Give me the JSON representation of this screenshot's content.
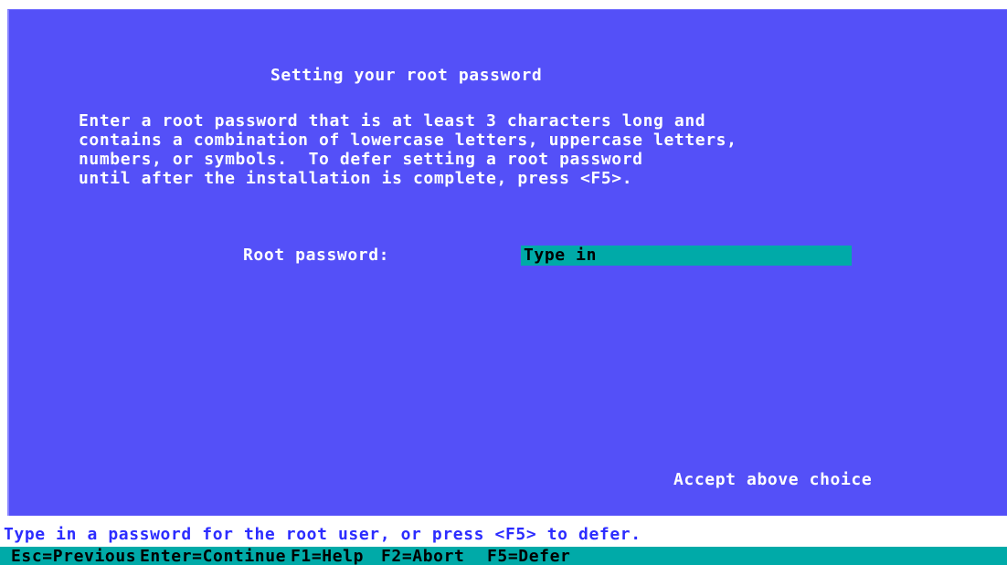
{
  "dialog": {
    "title": "Setting your root password",
    "description": "Enter a root password that is at least 3 characters long and\ncontains a combination of lowercase letters, uppercase letters,\nnumbers, or symbols.  To defer setting a root password\nuntil after the installation is complete, press <F5>.",
    "password_label": "Root password:",
    "password_placeholder": "Type in",
    "password_value": "",
    "accept_label": "Accept above choice"
  },
  "status_line": "Type in a password for the root user, or press <F5> to defer.",
  "keybar": [
    {
      "label": "Esc=Previous"
    },
    {
      "label": "Enter=Continue"
    },
    {
      "label": "F1=Help"
    },
    {
      "label": "F2=Abort"
    },
    {
      "label": "F5=Defer"
    }
  ],
  "colors": {
    "background": "#5450f8",
    "field": "#00aaa8",
    "text": "#ffffff",
    "status_text": "#2c2cff"
  }
}
